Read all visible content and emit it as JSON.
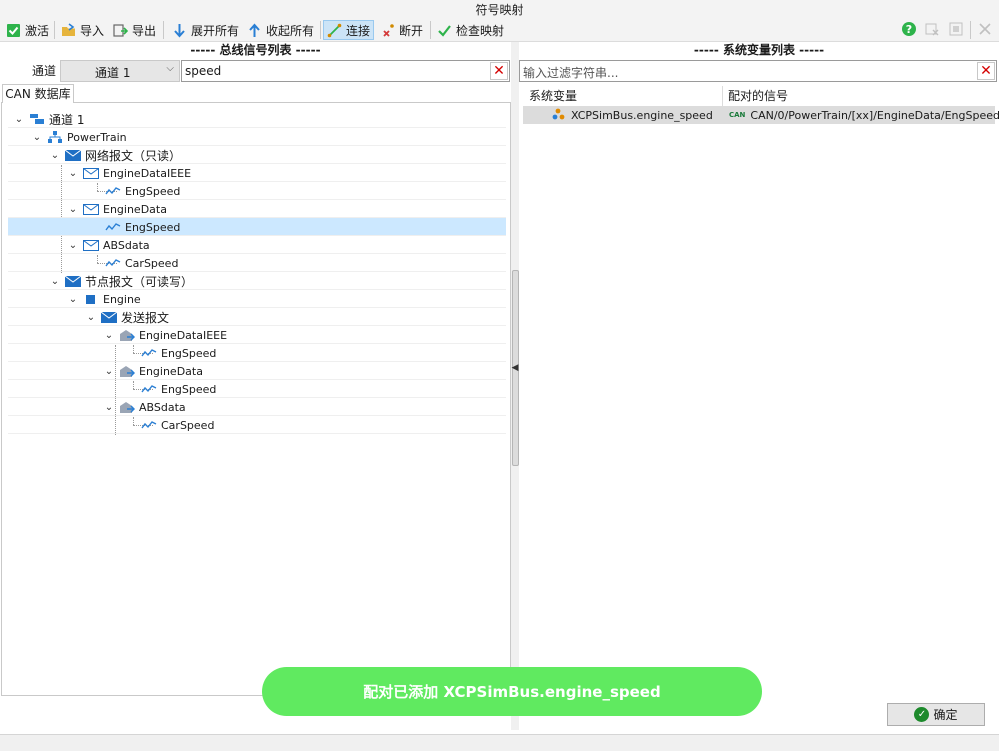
{
  "window": {
    "title": "符号映射"
  },
  "toolbar": {
    "activate": "激活",
    "import": "导入",
    "export": "导出",
    "expand_all": "展开所有",
    "collapse_all": "收起所有",
    "connect": "连接",
    "disconnect": "断开",
    "check_mapping": "检查映射"
  },
  "left": {
    "header": "----- 总线信号列表 -----",
    "channel_label": "通道",
    "channel_value": "通道 1",
    "search_value": "speed",
    "tab": "CAN 数据库"
  },
  "tree": [
    {
      "label": "通道 1",
      "icon": "channel-icon"
    },
    {
      "label": "PowerTrain",
      "icon": "network-icon"
    },
    {
      "label": "网络报文（只读）",
      "icon": "message-folder-icon"
    },
    {
      "label": "EngineDataIEEE",
      "icon": "message-icon"
    },
    {
      "label": "EngSpeed",
      "icon": "signal-icon"
    },
    {
      "label": "EngineData",
      "icon": "message-icon"
    },
    {
      "label": "EngSpeed",
      "icon": "signal-icon",
      "selected": true
    },
    {
      "label": "ABSdata",
      "icon": "message-icon"
    },
    {
      "label": "CarSpeed",
      "icon": "signal-icon"
    },
    {
      "label": "节点报文（可读写）",
      "icon": "message-folder-icon"
    },
    {
      "label": "Engine",
      "icon": "node-icon"
    },
    {
      "label": "发送报文",
      "icon": "message-folder-icon"
    },
    {
      "label": "EngineDataIEEE",
      "icon": "tx-message-icon"
    },
    {
      "label": "EngSpeed",
      "icon": "signal-icon"
    },
    {
      "label": "EngineData",
      "icon": "tx-message-icon"
    },
    {
      "label": "EngSpeed",
      "icon": "signal-icon"
    },
    {
      "label": "ABSdata",
      "icon": "tx-message-icon"
    },
    {
      "label": "CarSpeed",
      "icon": "signal-icon"
    }
  ],
  "right": {
    "header": "----- 系统变量列表 -----",
    "filter_placeholder": "输入过滤字符串...",
    "columns": [
      "系统变量",
      "配对的信号"
    ],
    "rows": [
      {
        "variable": "XCPSimBus.engine_speed",
        "signal_tag": "CAN",
        "signal": "CAN/0/PowerTrain/[xx]/EngineData/EngSpeed"
      }
    ]
  },
  "toast": {
    "text": "配对已添加 XCPSimBus.engine_speed"
  },
  "buttons": {
    "ok": "确定"
  },
  "colors": {
    "toast_bg": "#60ea60",
    "selection": "#cce8ff",
    "accent": "#2a7fd4"
  }
}
